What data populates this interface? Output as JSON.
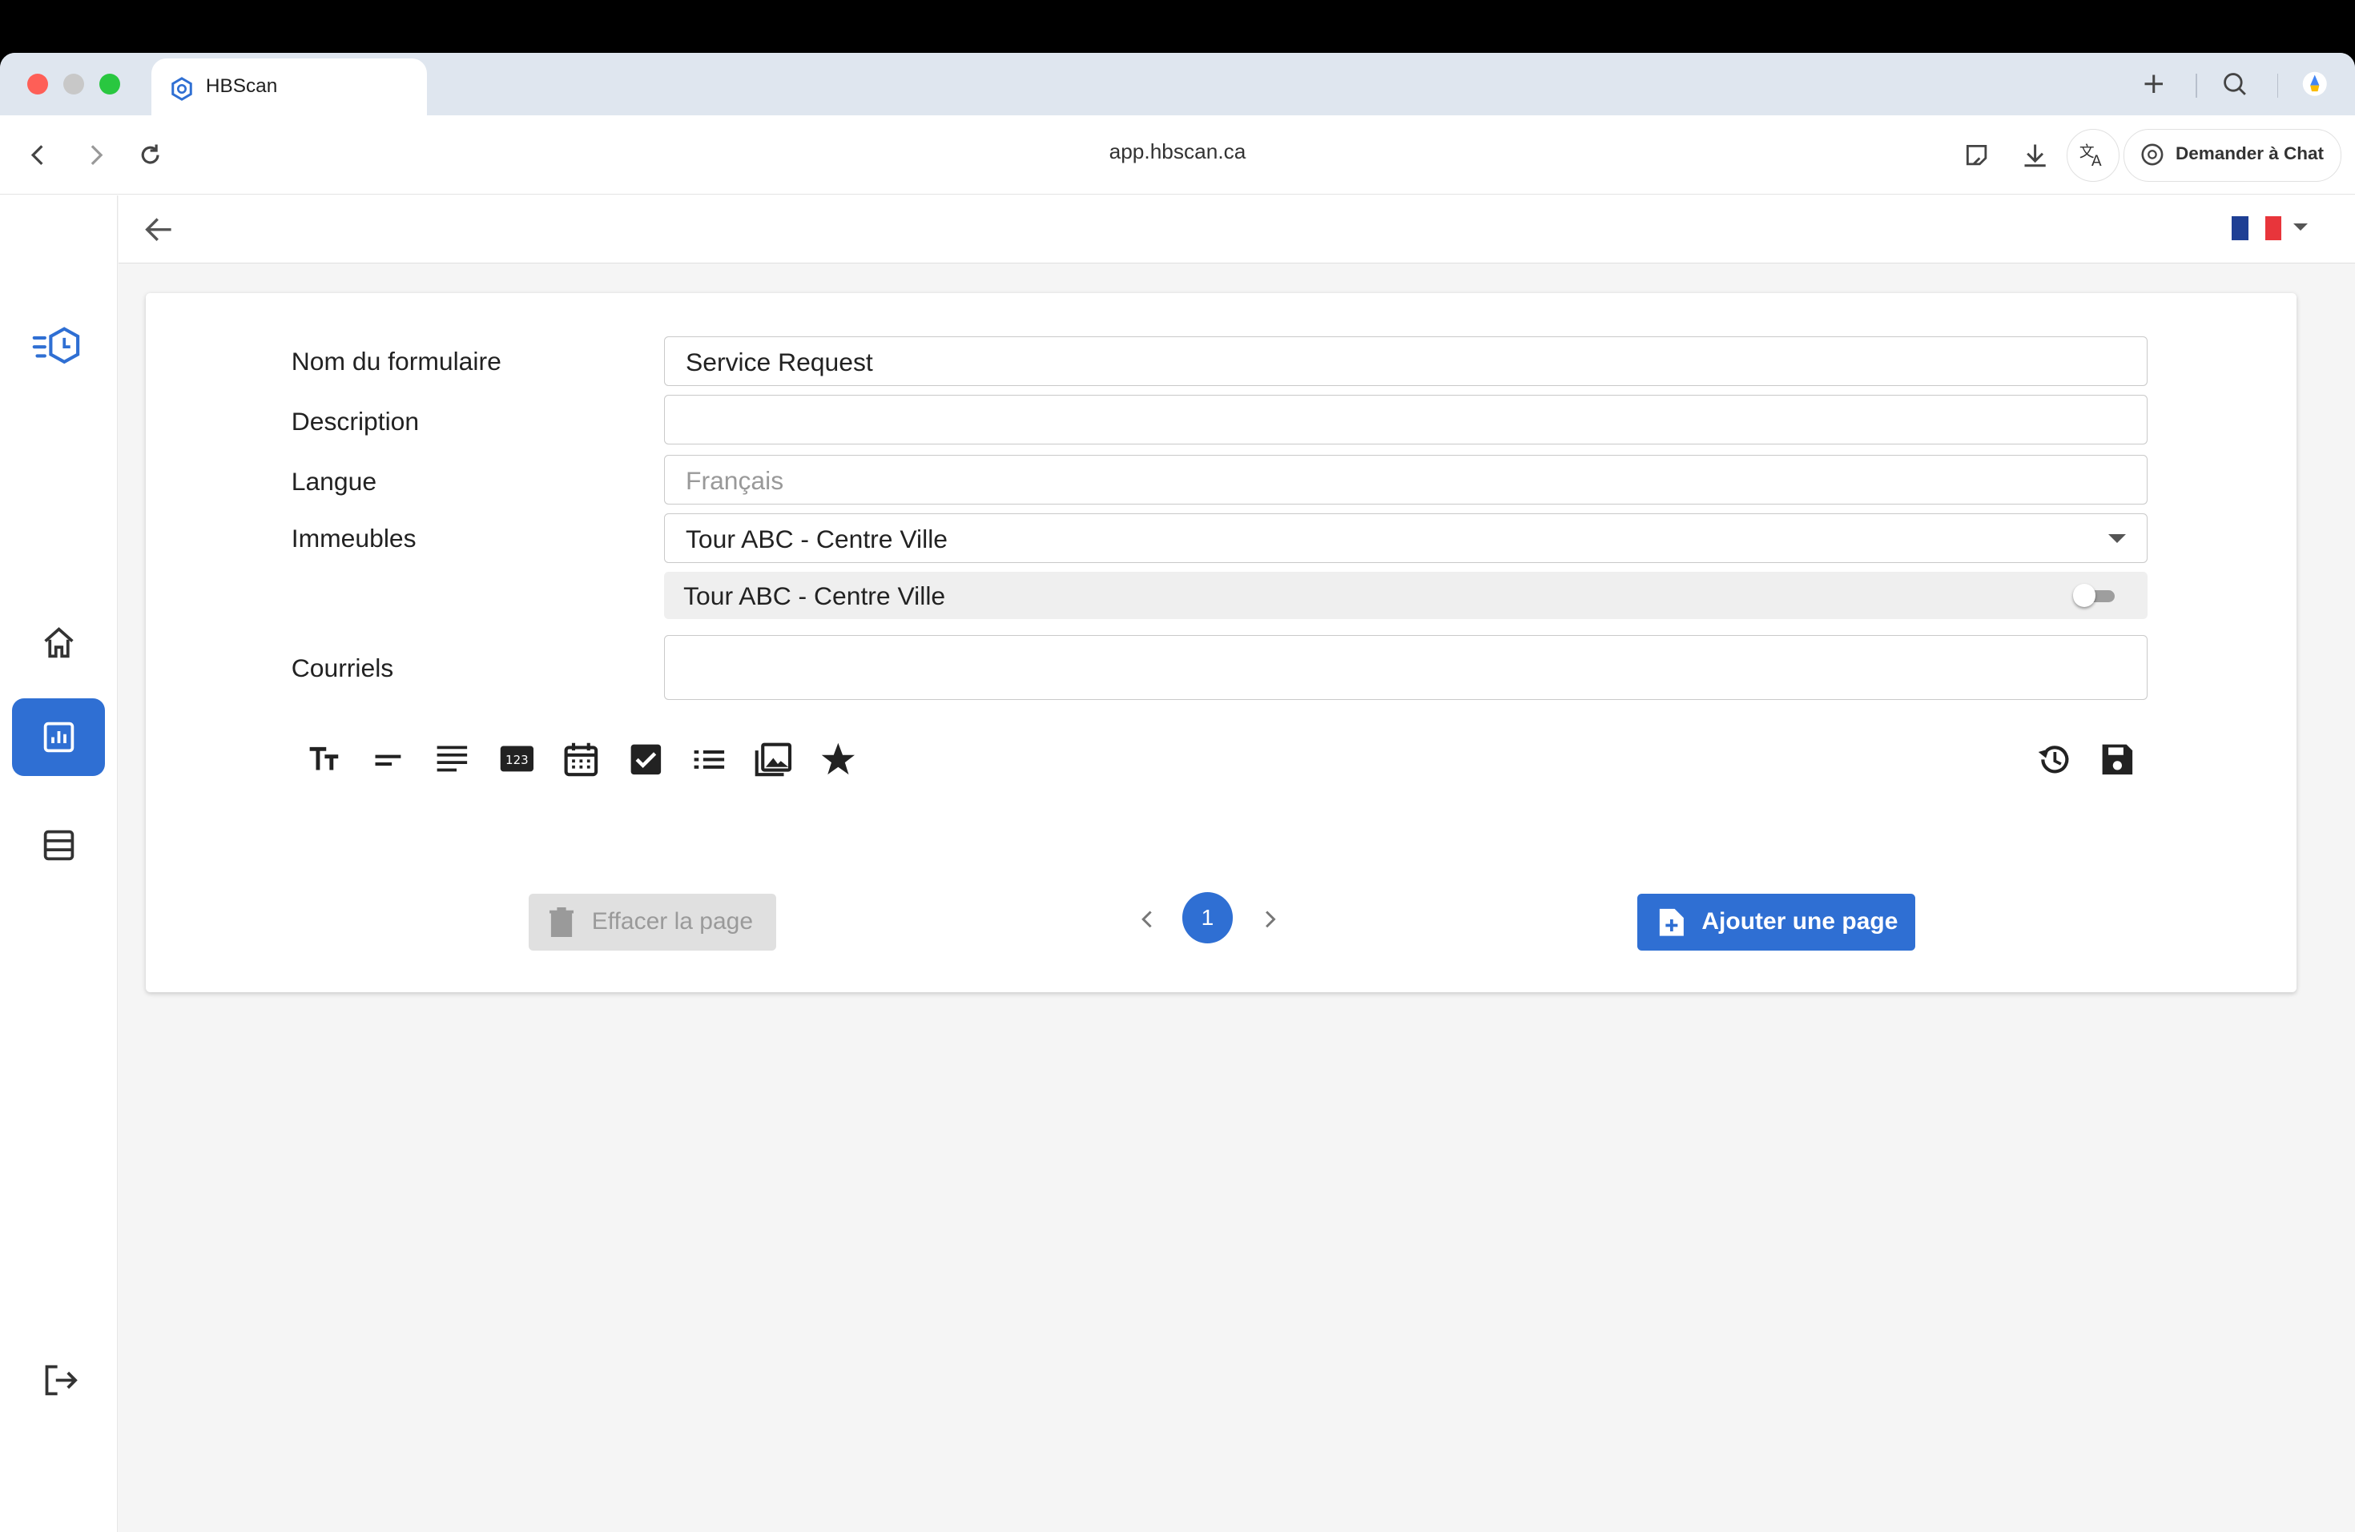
{
  "browser": {
    "tab_title": "HBScan",
    "url": "app.hbscan.ca",
    "chat_button_label": "Demander à Chat"
  },
  "form": {
    "name_label": "Nom du formulaire",
    "name_value": "Service Request",
    "description_label": "Description",
    "description_value": "",
    "language_label": "Langue",
    "language_placeholder": "Français",
    "buildings_label": "Immeubles",
    "buildings_selected": "Tour ABC - Centre Ville",
    "building_option": "Tour ABC - Centre Ville",
    "building_option_enabled": false,
    "emails_label": "Courriels",
    "emails_value": ""
  },
  "toolbar_tools": [
    "text-size-icon",
    "short-text-icon",
    "long-text-icon",
    "number-icon",
    "calendar-icon",
    "checkbox-icon",
    "list-icon",
    "image-icon",
    "star-icon",
    "history-icon",
    "save-icon"
  ],
  "footer": {
    "clear_page_label": "Effacer la page",
    "current_page": "1",
    "add_page_label": "Ajouter une page"
  },
  "colors": {
    "primary": "#2f6fd3",
    "disabled_bg": "#e0e0e0"
  },
  "language_flag": "fr-flag"
}
